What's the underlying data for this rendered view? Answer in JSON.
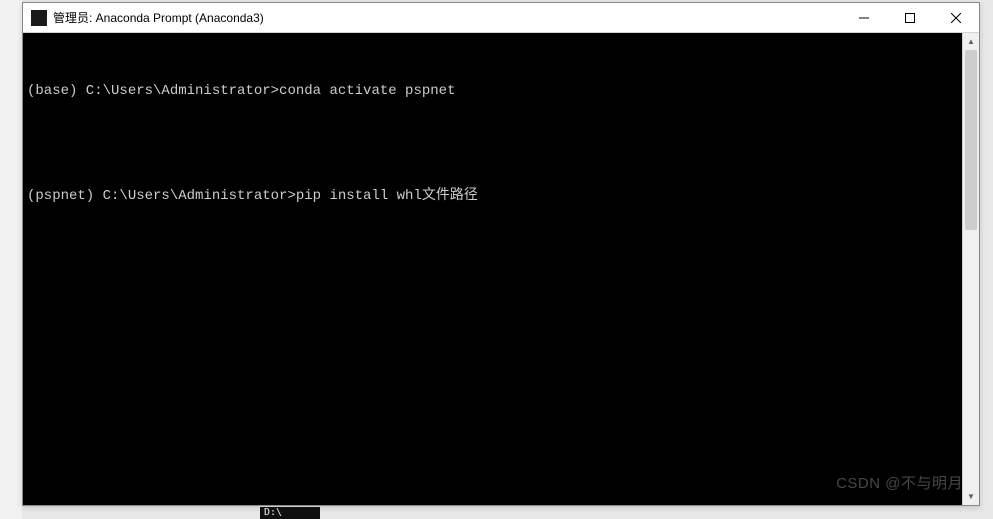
{
  "window": {
    "title": "管理员: Anaconda Prompt (Anaconda3)",
    "controls": {
      "minimize": "−",
      "maximize": "□",
      "close": "✕"
    }
  },
  "terminal": {
    "lines": [
      "(base) C:\\Users\\Administrator>conda activate pspnet",
      "",
      "(pspnet) C:\\Users\\Administrator>pip install whl文件路径"
    ]
  },
  "watermark": "CSDN @不与明月",
  "taskbar_fragment": "D:\\"
}
